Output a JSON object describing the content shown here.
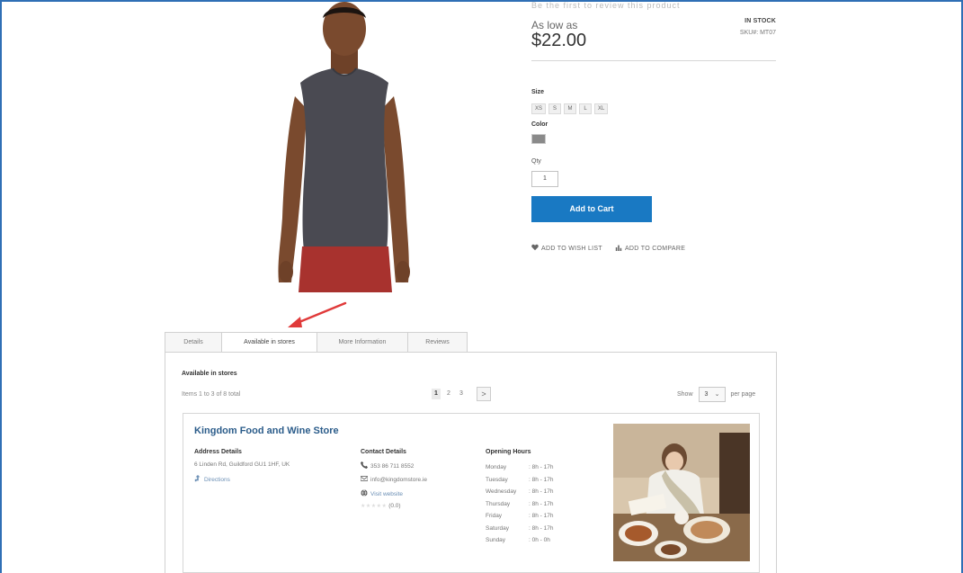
{
  "product": {
    "cut_off_text": "Be the first to review this product",
    "price_label": "As low as",
    "price": "$22.00",
    "stock_status": "IN STOCK",
    "sku": "SKU#: MT07",
    "size_label": "Size",
    "sizes": [
      "XS",
      "S",
      "M",
      "L",
      "XL"
    ],
    "color_label": "Color",
    "swatch_color": "#8a8a8a",
    "qty_label": "Qty",
    "qty_value": "1",
    "add_to_cart": "Add to Cart",
    "wishlist": "ADD TO WISH LIST",
    "compare": "ADD TO COMPARE"
  },
  "tabs": [
    {
      "label": "Details",
      "active": false
    },
    {
      "label": "Available in stores",
      "active": true
    },
    {
      "label": "More Information",
      "active": false
    },
    {
      "label": "Reviews",
      "active": false
    }
  ],
  "stores_panel": {
    "title": "Available in stores",
    "items_count": "Items 1 to 3 of 8 total",
    "pages": [
      "1",
      "2",
      "3"
    ],
    "current_page": "1",
    "next_symbol": ">",
    "show_label": "Show",
    "per_page_value": "3",
    "per_page_label": "per page"
  },
  "store": {
    "name": "Kingdom Food and Wine Store",
    "address_heading": "Address Details",
    "address": "6 Linden Rd, Guildford GU1 1HF, UK",
    "directions": "Directions",
    "contact_heading": "Contact Details",
    "phone": "353 86 711 8552",
    "email": "info@kingdomstore.ie",
    "website": "Visit website",
    "rating_stars": "★★★★★",
    "rating_value": "(0.0)",
    "hours_heading": "Opening Hours",
    "hours": [
      {
        "day": "Monday",
        "time": ": 8h - 17h"
      },
      {
        "day": "Tuesday",
        "time": ": 8h - 17h"
      },
      {
        "day": "Wednesday",
        "time": ": 8h - 17h"
      },
      {
        "day": "Thursday",
        "time": ": 8h - 17h"
      },
      {
        "day": "Friday",
        "time": ": 8h - 17h"
      },
      {
        "day": "Saturday",
        "time": ": 8h - 17h"
      },
      {
        "day": "Sunday",
        "time": ": 0h - 0h"
      }
    ]
  },
  "colors": {
    "accent_blue": "#1979c3",
    "annotation_arrow": "#e03a3a",
    "store_name": "#2b5c8a"
  }
}
